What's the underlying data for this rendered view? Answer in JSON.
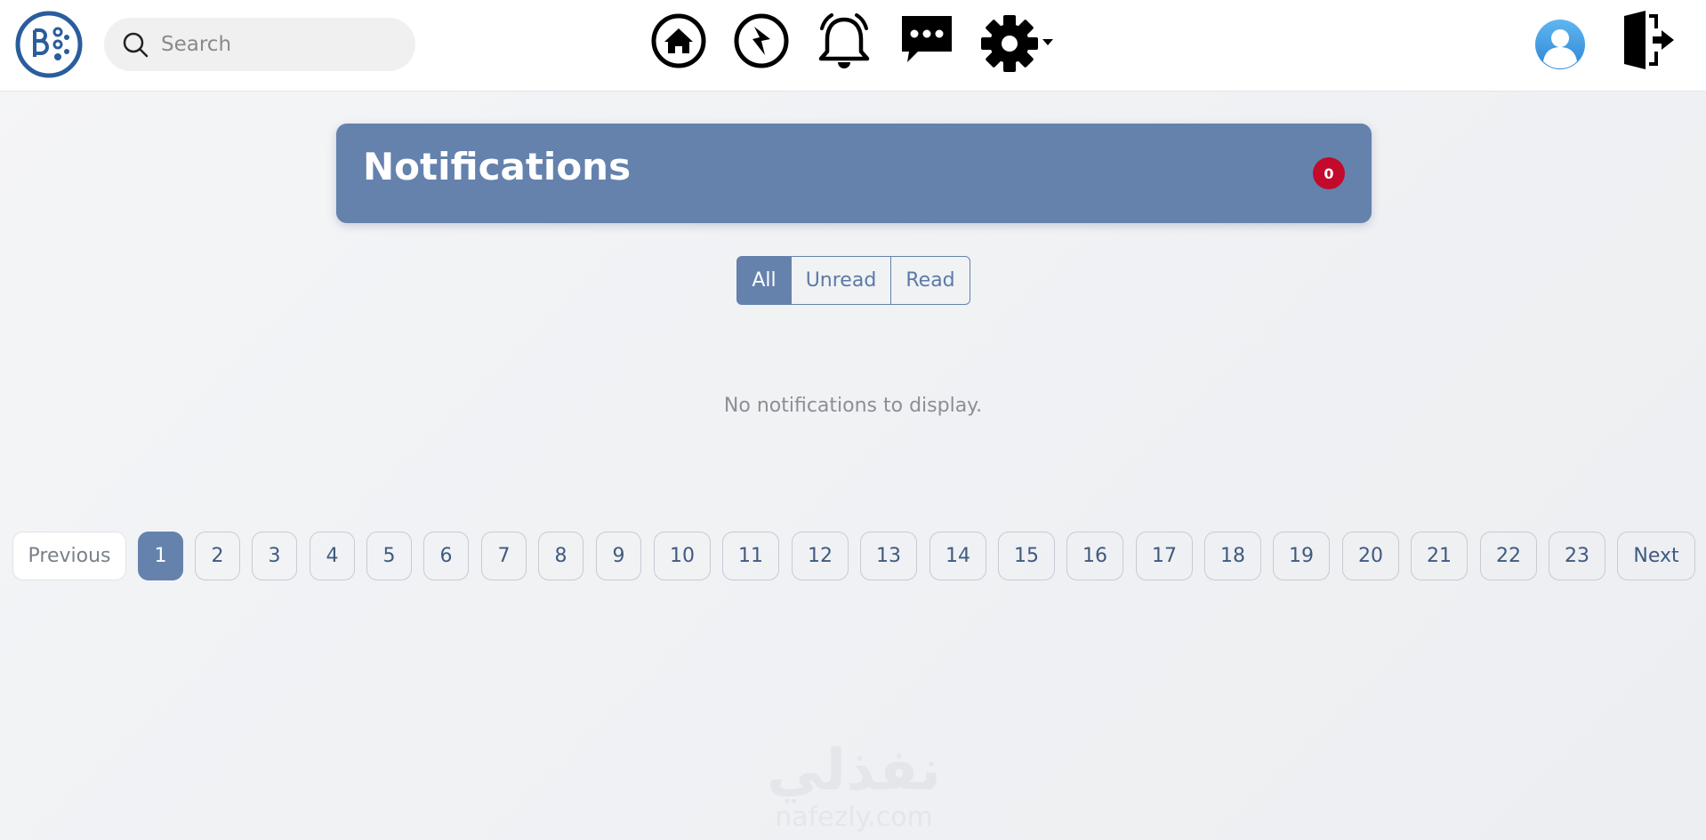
{
  "topbar": {
    "logo_icon": "app-logo-icon",
    "search": {
      "placeholder": "Search",
      "value": ""
    },
    "nav_icons": [
      "home-icon",
      "explore-compass-icon",
      "bell-icon",
      "chat-icon",
      "settings-gear-icon"
    ],
    "avatar_icon": "user-avatar-icon",
    "logout_icon": "logout-door-icon"
  },
  "header": {
    "title": "Notifications",
    "badge_count": "0",
    "background_color": "#6582ad",
    "badge_color": "#c3092c"
  },
  "filters": [
    {
      "label": "All",
      "active": true
    },
    {
      "label": "Unread",
      "active": false
    },
    {
      "label": "Read",
      "active": false
    }
  ],
  "empty_message": "No notifications to display.",
  "pagination": {
    "previous": "Previous",
    "next": "Next",
    "current_page": "1",
    "pages": [
      "1",
      "2",
      "3",
      "4",
      "5",
      "6",
      "7",
      "8",
      "9",
      "10",
      "11",
      "12",
      "13",
      "14",
      "15",
      "16",
      "17",
      "18",
      "19",
      "20",
      "21",
      "22",
      "23"
    ]
  },
  "watermark": {
    "arabic": "نفذلي",
    "latin": "nafezly.com"
  }
}
